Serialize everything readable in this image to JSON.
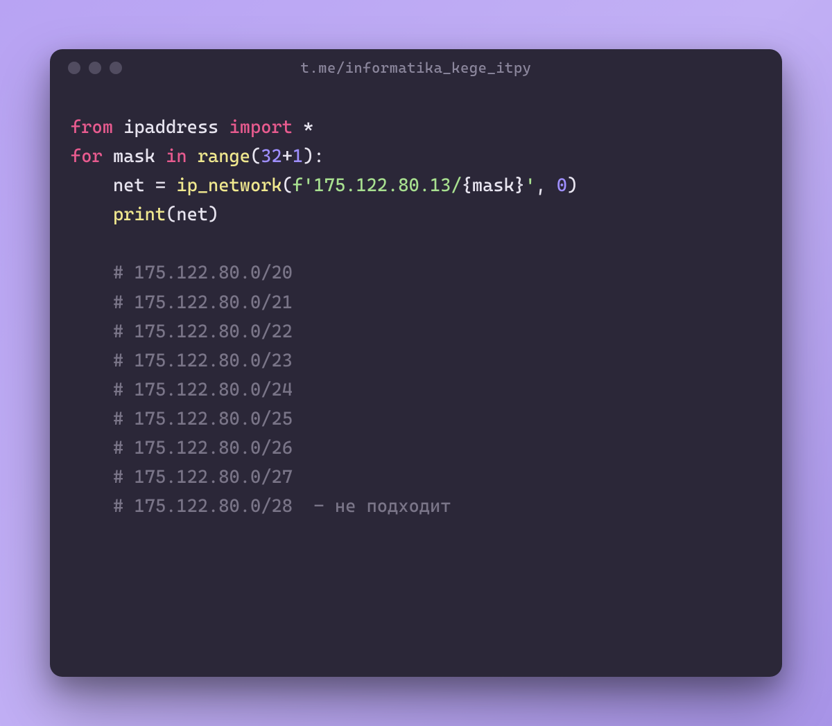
{
  "window": {
    "title": "t.me/informatika_kege_itpy"
  },
  "code": {
    "line1": {
      "from": "from",
      "module": "ipaddress",
      "import": "import",
      "star": "*"
    },
    "line2": {
      "for": "for",
      "var": "mask",
      "in": "in",
      "func": "range",
      "num": "32",
      "plus": "+",
      "one": "1",
      "colon": ":"
    },
    "line3": {
      "indent": "    ",
      "var": "net",
      "eq": "=",
      "func": "ip_network",
      "fprefix": "f",
      "q1": "'",
      "str1": "175.122.80.13/",
      "lbrace": "{",
      "fvar": "mask",
      "rbrace": "}",
      "q2": "'",
      "comma": ",",
      "zero": "0"
    },
    "line4": {
      "indent": "    ",
      "func": "print",
      "arg": "net"
    },
    "comments": {
      "c1": "    # 175.122.80.0/20",
      "c2": "    # 175.122.80.0/21",
      "c3": "    # 175.122.80.0/22",
      "c4": "    # 175.122.80.0/23",
      "c5": "    # 175.122.80.0/24",
      "c6": "    # 175.122.80.0/25",
      "c7": "    # 175.122.80.0/26",
      "c8": "    # 175.122.80.0/27",
      "c9": "    # 175.122.80.0/28  - не подходит"
    }
  }
}
